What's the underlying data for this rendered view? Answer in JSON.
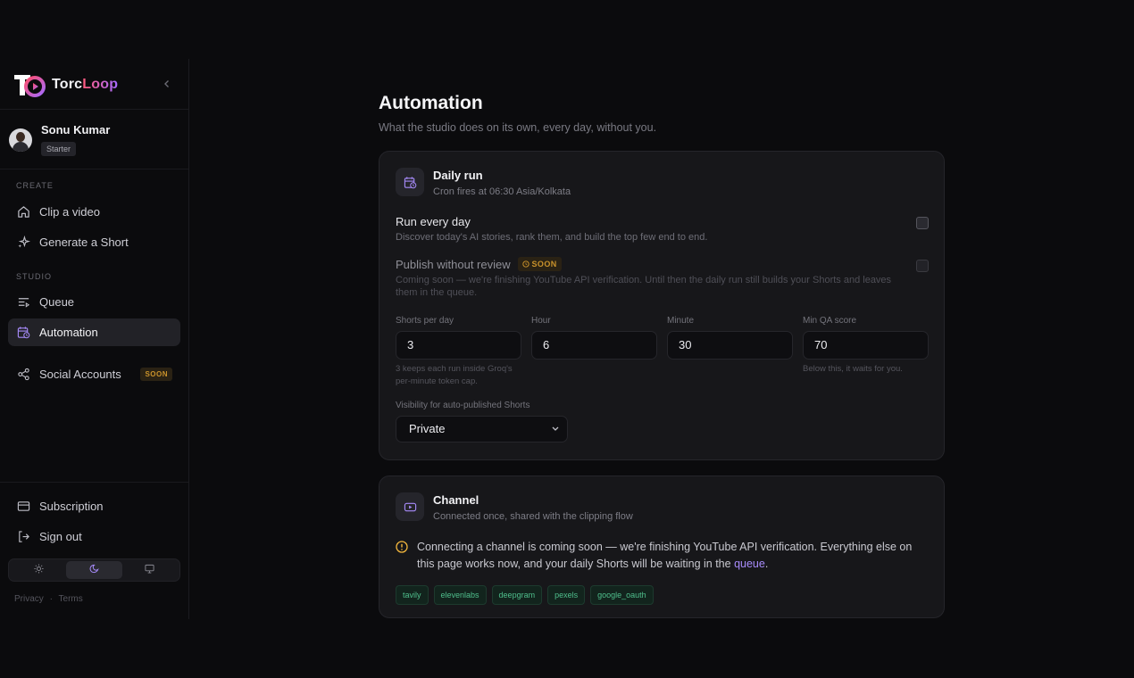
{
  "brand": {
    "name_prefix": "Torc",
    "name_suffix": "Loop",
    "collapse_icon": "chevron-left-icon"
  },
  "user": {
    "name": "Sonu Kumar",
    "plan": "Starter"
  },
  "sidebar": {
    "create_label": "CREATE",
    "studio_label": "STUDIO",
    "items": [
      {
        "label": "Clip a video",
        "icon": "home-icon"
      },
      {
        "label": "Generate a Short",
        "icon": "sparkles-icon"
      },
      {
        "label": "Queue",
        "icon": "queue-icon"
      },
      {
        "label": "Automation",
        "icon": "calendar-clock-icon",
        "active": true
      },
      {
        "label": "Social Accounts",
        "icon": "share-icon",
        "badge": "SOON"
      }
    ],
    "bottom": [
      {
        "label": "Subscription",
        "icon": "credit-card-icon"
      },
      {
        "label": "Sign out",
        "icon": "sign-out-icon"
      }
    ],
    "theme": {
      "options": [
        "light",
        "dark",
        "system"
      ],
      "selected": "dark"
    },
    "legal": {
      "privacy": "Privacy",
      "separator": "·",
      "terms": "Terms"
    }
  },
  "page": {
    "title": "Automation",
    "subtitle": "What the studio does on its own, every day, without you."
  },
  "daily_run": {
    "title": "Daily run",
    "subtitle": "Cron fires at 06:30 Asia/Kolkata",
    "run_every_day": {
      "title": "Run every day",
      "desc": "Discover today's AI stories, rank them, and build the top few end to end.",
      "checked": false
    },
    "publish_without_review": {
      "title": "Publish without review",
      "badge": "SOON",
      "desc": "Coming soon — we're finishing YouTube API verification. Until then the daily run still builds your Shorts and leaves them in the queue.",
      "checked": false,
      "disabled": true
    },
    "fields": {
      "shorts_per_day": {
        "label": "Shorts per day",
        "value": "3",
        "hint": "3 keeps each run inside Groq's per-minute token cap."
      },
      "hour": {
        "label": "Hour",
        "value": "6"
      },
      "minute": {
        "label": "Minute",
        "value": "30"
      },
      "min_qa": {
        "label": "Min QA score",
        "value": "70",
        "hint": "Below this, it waits for you."
      }
    },
    "visibility": {
      "label": "Visibility for auto-published Shorts",
      "value": "Private"
    }
  },
  "channel": {
    "title": "Channel",
    "subtitle": "Connected once, shared with the clipping flow",
    "notice_text": "Connecting a channel is coming soon — we're finishing YouTube API verification. Everything else on this page works now, and your daily Shorts will be waiting in the ",
    "notice_link": "queue",
    "notice_end": ".",
    "tags": [
      "tavily",
      "elevenlabs",
      "deepgram",
      "pexels",
      "google_oauth"
    ]
  },
  "colors": {
    "accent": "#a78bfa",
    "warning": "#f5b83d",
    "success": "#4fbf8c",
    "background": "#0b0b0d",
    "card": "#17171a"
  }
}
